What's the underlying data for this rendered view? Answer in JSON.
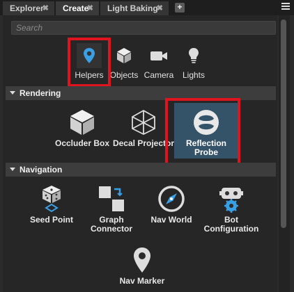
{
  "tabs": [
    {
      "label": "Explorer"
    },
    {
      "label": "Create"
    },
    {
      "label": "Light Baking"
    }
  ],
  "tab_close_glyph": "✖",
  "tab_add_glyph": "+",
  "search": {
    "placeholder": "Search"
  },
  "categories": [
    {
      "label": "Helpers",
      "icon": "map-pin-icon",
      "selected": true
    },
    {
      "label": "Objects",
      "icon": "cube-icon"
    },
    {
      "label": "Camera",
      "icon": "camera-icon"
    },
    {
      "label": "Lights",
      "icon": "lightbulb-icon"
    }
  ],
  "sections": {
    "rendering": {
      "title": "Rendering",
      "items": [
        {
          "label": "Occluder Box",
          "icon": "cube-icon"
        },
        {
          "label": "Decal Projector",
          "icon": "wireframe-cube-icon"
        },
        {
          "label": "Reflection Probe",
          "icon": "reflection-probe-icon",
          "selected": true
        }
      ]
    },
    "navigation": {
      "title": "Navigation",
      "items": [
        {
          "label": "Seed Point",
          "icon": "dice-icon"
        },
        {
          "label": "Graph Connector",
          "icon": "graph-connector-icon"
        },
        {
          "label": "Nav World",
          "icon": "compass-icon"
        },
        {
          "label": "Bot Configuration",
          "icon": "robot-gear-icon"
        },
        {
          "label": "Nav Marker",
          "icon": "map-pin-icon"
        }
      ]
    }
  },
  "colors": {
    "accent": "#3aa0e6",
    "selected_item_bg": "#355368",
    "highlight_box": "#e0141e"
  }
}
